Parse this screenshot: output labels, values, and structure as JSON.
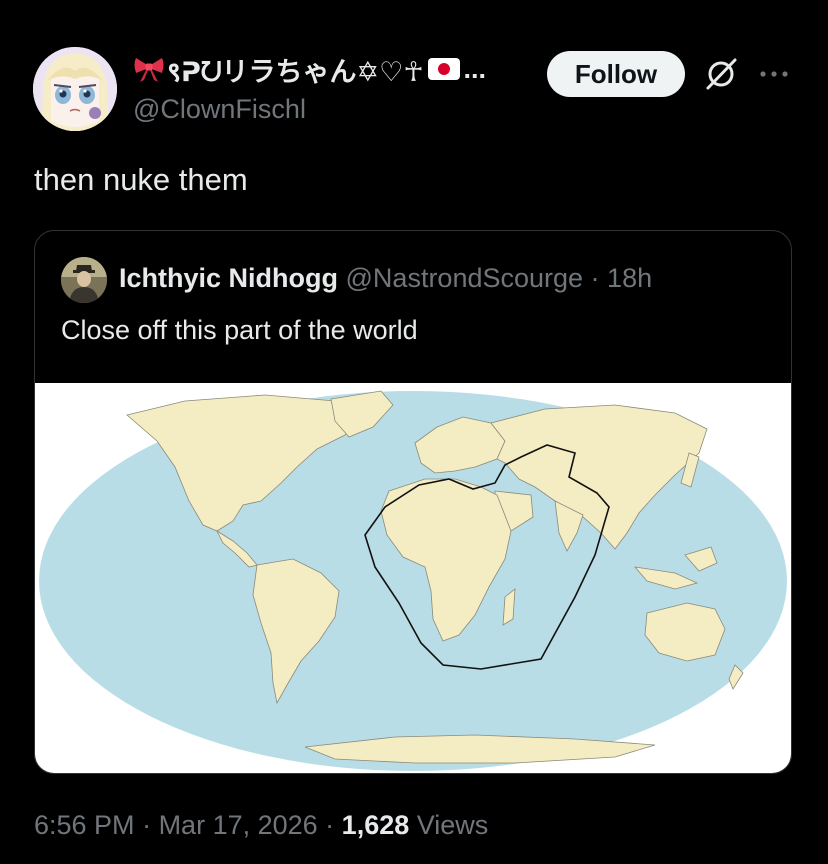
{
  "author": {
    "display_name": "९ᕈᘢリラちゃん✡♡☥",
    "display_name_overflow": "...",
    "handle": "@ClownFischl",
    "avatar_icon": "anime-avatar"
  },
  "actions": {
    "follow_label": "Follow",
    "grok_icon": "grok-icon",
    "more_icon": "more-icon"
  },
  "tweet": {
    "text": "then nuke them"
  },
  "quote": {
    "author_name": "Ichthyic Nidhogg",
    "author_handle": "@NastrondScourge",
    "separator": " · ",
    "time_ago": "18h",
    "text": "Close off this part of the world",
    "media_icon": "world-map"
  },
  "meta": {
    "time": "6:56 PM",
    "separator": " · ",
    "date": "Mar 17, 2026",
    "views_count": "1,628",
    "views_label": "Views"
  },
  "colors": {
    "background": "#000000",
    "text": "#e7e9ea",
    "muted": "#71767b",
    "ocean": "#b9dde6",
    "land": "#f4ecc2"
  }
}
